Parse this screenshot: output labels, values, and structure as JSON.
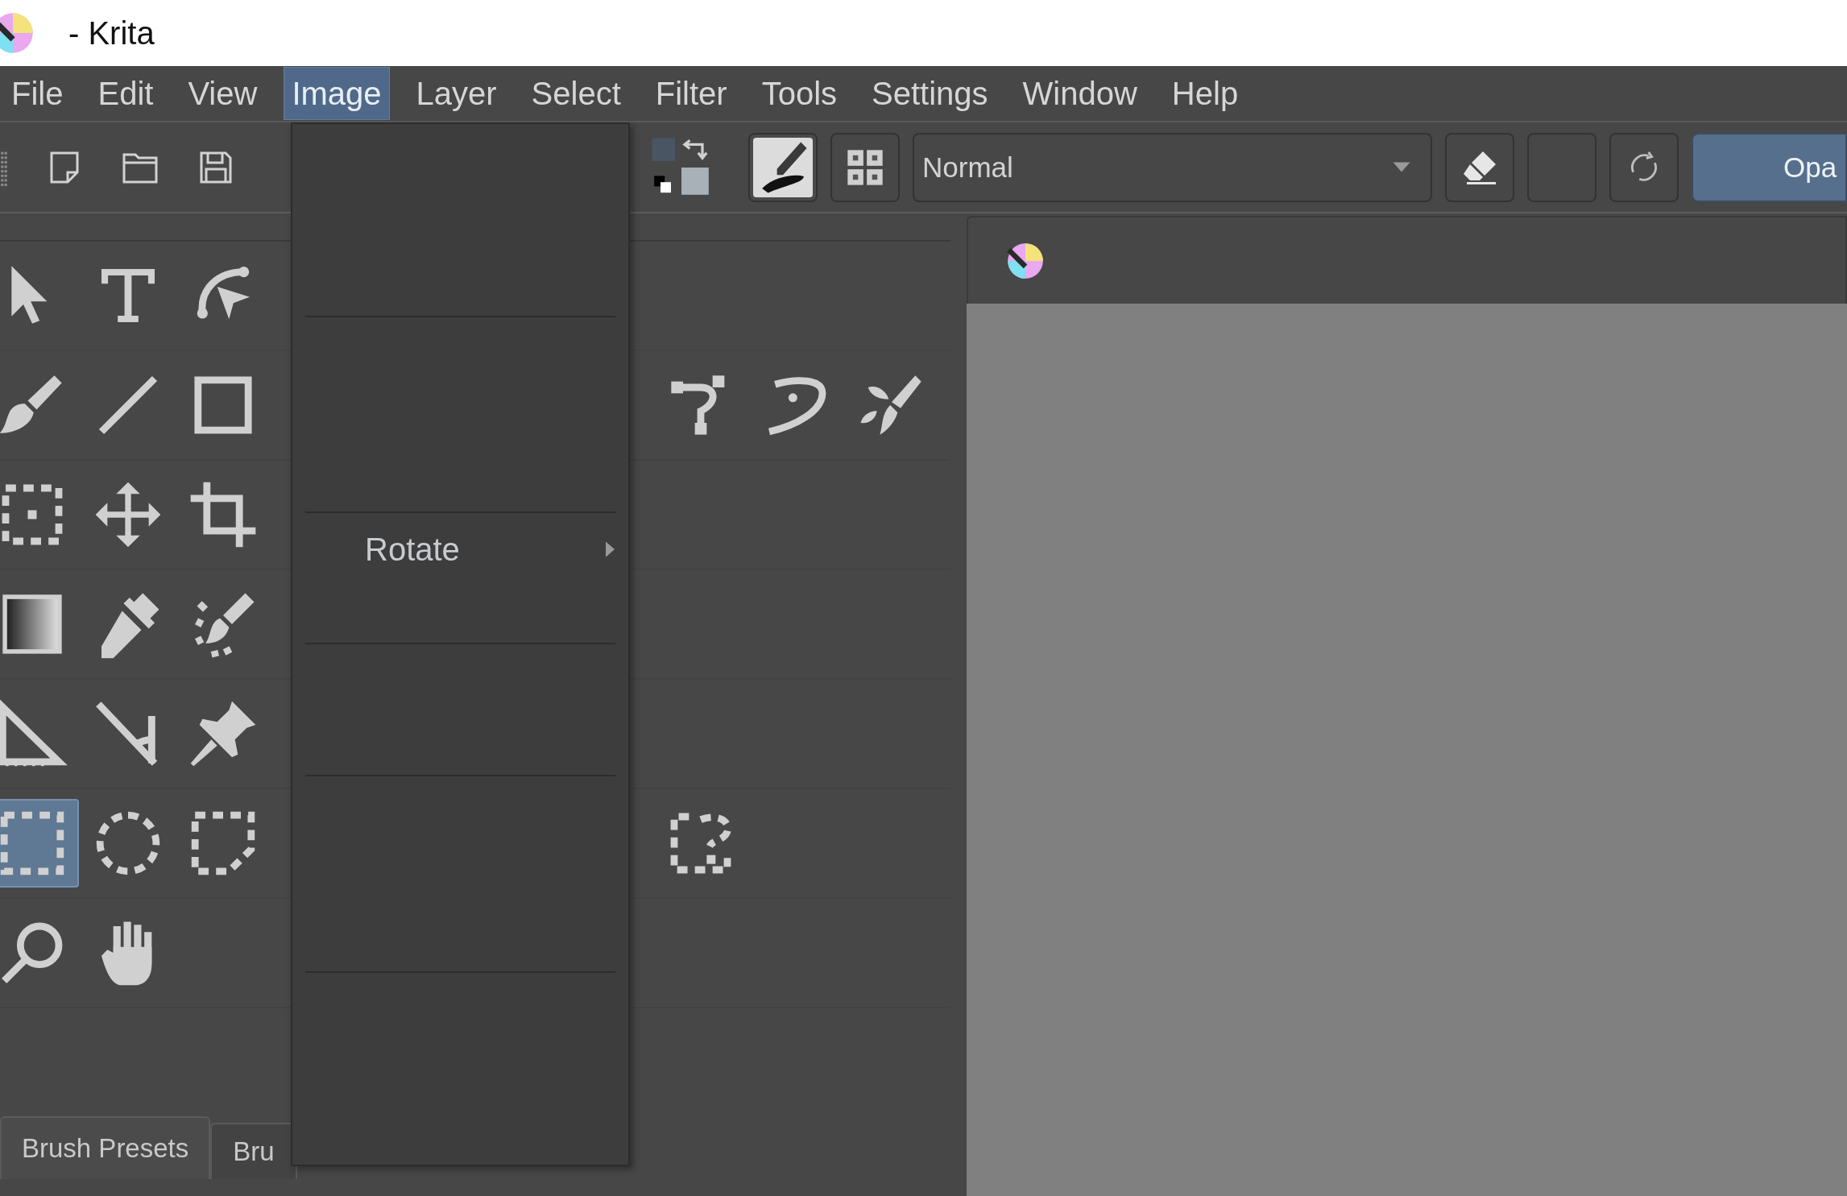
{
  "window": {
    "title": "- Krita"
  },
  "menu_bar": [
    {
      "label": "File",
      "selected": false
    },
    {
      "label": "Edit",
      "selected": false
    },
    {
      "label": "View",
      "selected": false
    },
    {
      "label": "Image",
      "selected": true
    },
    {
      "label": "Layer",
      "selected": false
    },
    {
      "label": "Select",
      "selected": false
    },
    {
      "label": "Filter",
      "selected": false
    },
    {
      "label": "Tools",
      "selected": false
    },
    {
      "label": "Settings",
      "selected": false
    },
    {
      "label": "Window",
      "selected": false
    },
    {
      "label": "Help",
      "selected": false
    }
  ],
  "toolbar": {
    "blend_mode": "Normal",
    "opacity": {
      "label": "Opa",
      "level": 1
    }
  },
  "image_menu": {
    "items": [
      {
        "label": "Rotate",
        "kind": "submenu"
      }
    ]
  },
  "toolbox": {
    "rows": [
      {
        "tools": [
          {
            "kind": "select-shapes",
            "selected": false
          },
          {
            "kind": "text",
            "selected": false
          },
          {
            "kind": "edit-shapes",
            "selected": false
          }
        ]
      },
      {
        "tools": [
          {
            "kind": "brush",
            "selected": false
          },
          {
            "kind": "line",
            "selected": false
          },
          {
            "kind": "rectangle",
            "selected": false
          }
        ],
        "more_tools": [
          {
            "kind": "bezier",
            "selected": false
          },
          {
            "kind": "freehand-path",
            "selected": false
          },
          {
            "kind": "multibrush",
            "selected": false
          }
        ]
      },
      {
        "tools": [
          {
            "kind": "transform",
            "selected": false
          },
          {
            "kind": "move",
            "selected": false
          },
          {
            "kind": "crop",
            "selected": false
          }
        ]
      },
      {
        "tools": [
          {
            "kind": "gradient",
            "selected": false
          },
          {
            "kind": "color-picker",
            "selected": false
          },
          {
            "kind": "smart-patch",
            "selected": false
          }
        ]
      },
      {
        "tools": [
          {
            "kind": "assistant",
            "selected": false
          },
          {
            "kind": "measure",
            "selected": false
          },
          {
            "kind": "reference",
            "selected": false
          }
        ]
      },
      {
        "tools": [
          {
            "kind": "rect-select",
            "selected": true
          },
          {
            "kind": "ellipse-select",
            "selected": false
          },
          {
            "kind": "polygon-select",
            "selected": false
          }
        ],
        "more_tools": [
          {
            "kind": "similar-select",
            "selected": false
          }
        ]
      },
      {
        "tools": [
          {
            "kind": "zoom",
            "selected": false
          },
          {
            "kind": "pan",
            "selected": false
          }
        ]
      }
    ]
  },
  "docker_tabs": [
    {
      "label": "Brush Presets",
      "selected": true
    },
    {
      "label": "Bru",
      "selected": false
    }
  ]
}
